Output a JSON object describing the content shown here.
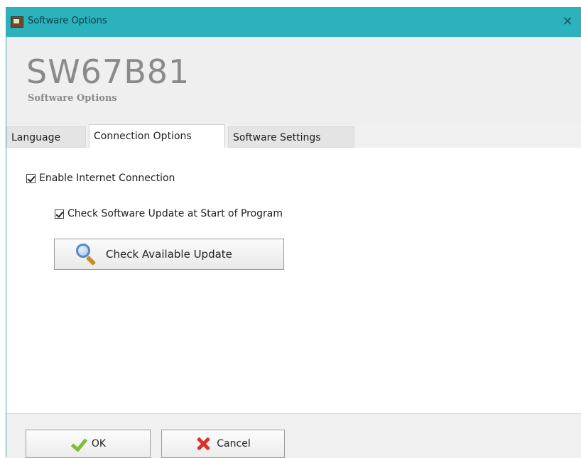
{
  "window": {
    "title": "Software Options",
    "close_glyph": "✕",
    "app_icon": "app-icon",
    "titlebar_color": "#2bb2bc"
  },
  "header": {
    "product_name": "SW67B81",
    "subtitle": "Software Options"
  },
  "tabs": [
    {
      "label": "Language",
      "active": false
    },
    {
      "label": "Connection Options",
      "active": true
    },
    {
      "label": "Software Settings",
      "active": false
    }
  ],
  "connection": {
    "enable_internet": {
      "label": "Enable Internet Connection",
      "checked": true
    },
    "check_update_at_start": {
      "label": "Check Software Update at Start of Program",
      "checked": true
    },
    "check_available_update": {
      "label": "Check Available Update",
      "icon": "magnifier-icon"
    }
  },
  "footer": {
    "ok_label": "OK",
    "ok_icon": "checkmark-icon",
    "cancel_label": "Cancel",
    "cancel_icon": "x-icon"
  }
}
